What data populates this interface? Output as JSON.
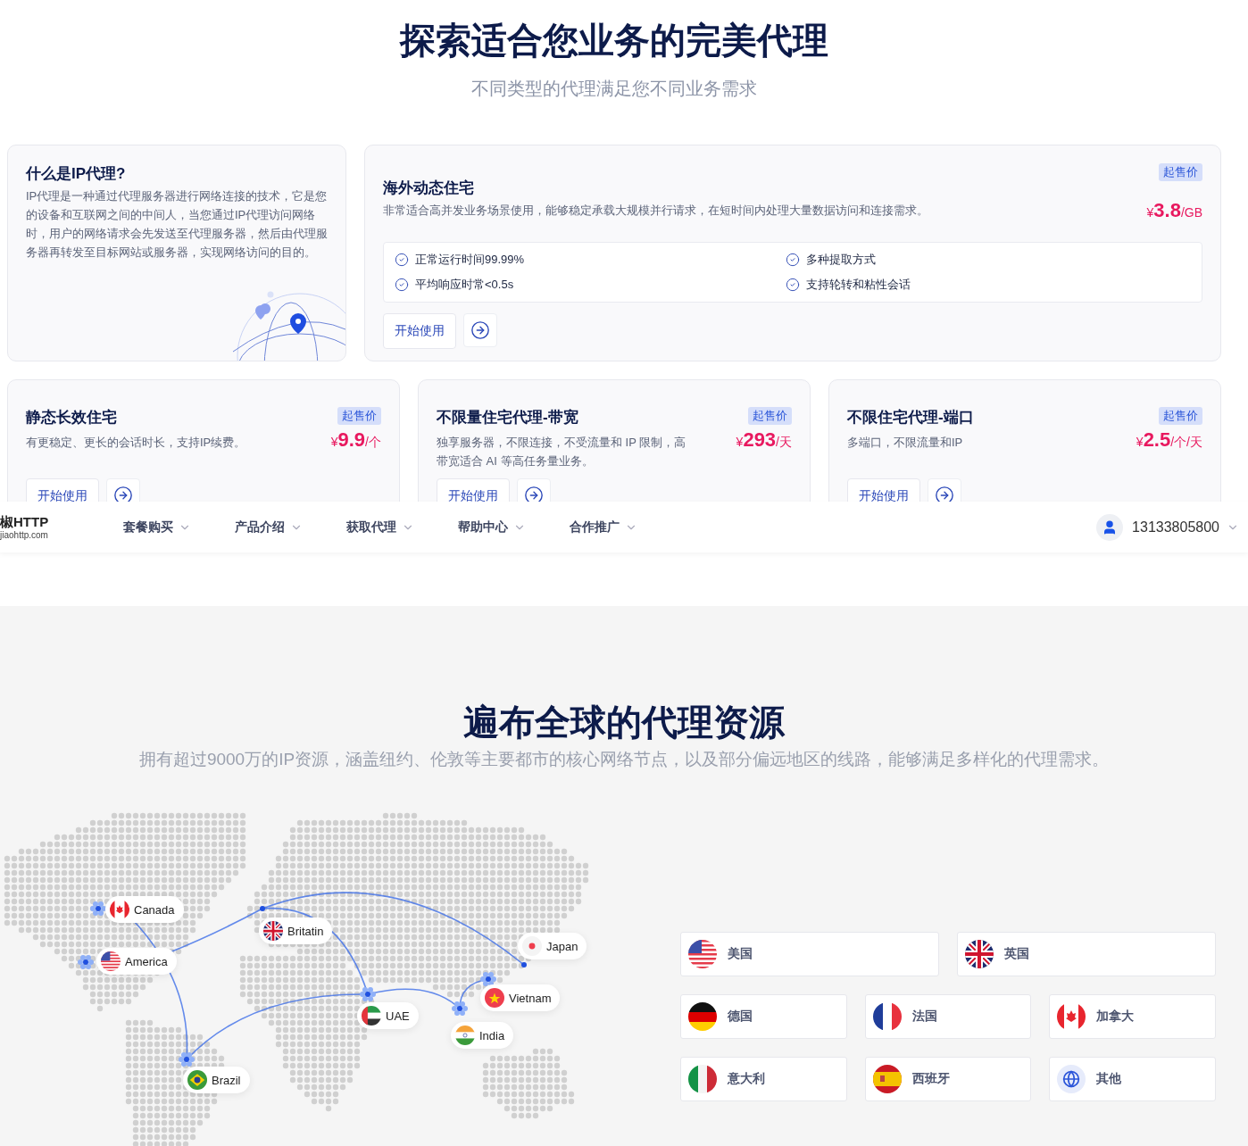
{
  "hero": {
    "title": "探索适合您业务的完美代理",
    "subtitle": "不同类型的代理满足您不同业务需求"
  },
  "intro_card": {
    "title": "什么是IP代理?",
    "text": "IP代理是一种通过代理服务器进行网络连接的技术，它是您的设备和互联网之间的中间人，当您通过IP代理访问网络时，用户的网络请求会先发送至代理服务器，然后由代理服务器再转发至目标网站或服务器，实现网络访问的目的。"
  },
  "featured_product": {
    "title": "海外动态住宅",
    "description": "非常适合高并发业务场景使用，能够稳定承载大规模并行请求，在短时间内处理大量数据访问和连接需求。",
    "badge": "起售价",
    "price": {
      "currency": "¥",
      "amount": "3.8",
      "unit": "/GB"
    },
    "features": [
      "正常运行时间99.99%",
      "多种提取方式",
      "平均响应时常<0.5s",
      "支持轮转和粘性会话"
    ],
    "button": "开始使用"
  },
  "products": [
    {
      "title": "静态长效住宅",
      "description": "有更稳定、更长的会话时长，支持IP续费。",
      "badge": "起售价",
      "price": {
        "currency": "¥",
        "amount": "9.9",
        "unit": "/个"
      },
      "button": "开始使用"
    },
    {
      "title": "不限量住宅代理-带宽",
      "description": "独享服务器，不限连接，不受流量和 IP 限制，高带宽适合 AI 等高任务量业务。",
      "badge": "起售价",
      "price": {
        "currency": "¥",
        "amount": "293",
        "unit": "/天"
      },
      "button": "开始使用"
    },
    {
      "title": "不限住宅代理-端口",
      "description": "多端口，不限流量和IP",
      "badge": "起售价",
      "price": {
        "currency": "¥",
        "amount": "2.5",
        "unit": "/个/天"
      },
      "button": "开始使用"
    }
  ],
  "navbar": {
    "logo": "椒HTTP",
    "domain": "jiaohttp.com",
    "items": [
      "套餐购买",
      "产品介绍",
      "获取代理",
      "帮助中心",
      "合作推广"
    ],
    "user": "13133805800"
  },
  "coverage": {
    "title": "遍布全球的代理资源",
    "subtitle": "拥有超过9000万的IP资源，涵盖纽约、伦敦等主要都市的核心网络节点，以及部分偏远地区的线路，能够满足多样化的代理需求。",
    "map_labels": [
      "Canada",
      "America",
      "Britatin",
      "Japan",
      "Vietnam",
      "UAE",
      "India",
      "Brazil"
    ],
    "countries": [
      "美国",
      "英国",
      "德国",
      "法国",
      "加拿大",
      "意大利",
      "西班牙",
      "其他"
    ]
  }
}
